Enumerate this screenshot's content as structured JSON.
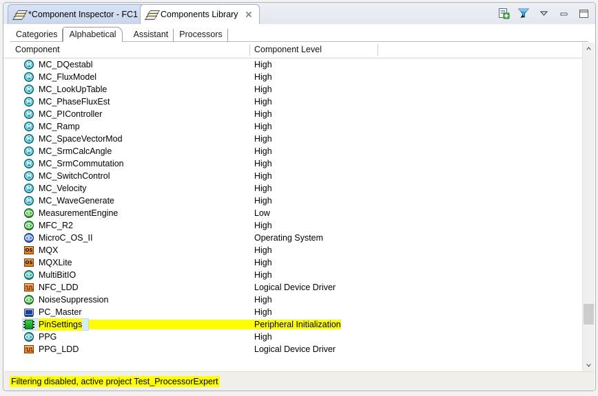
{
  "window": {
    "editor_tabs": [
      {
        "label": "*Component Inspector - FC1",
        "icon": "stacked-sheets-icon",
        "active": false,
        "closable": false
      },
      {
        "label": "Components Library",
        "icon": "stacked-sheets-icon",
        "active": true,
        "closable": true
      }
    ],
    "toolbar_icons": [
      {
        "name": "new-component-icon",
        "title": "New"
      },
      {
        "name": "filter-icon",
        "title": "Filter"
      },
      {
        "name": "view-menu-icon",
        "title": "View Menu"
      },
      {
        "name": "minimize-icon",
        "title": "Minimize"
      },
      {
        "name": "maximize-icon",
        "title": "Maximize"
      }
    ]
  },
  "subtabs": [
    {
      "label": "Categories",
      "selected": false
    },
    {
      "label": "Alphabetical",
      "selected": true
    },
    {
      "label": "Assistant",
      "selected": false
    },
    {
      "label": "Processors",
      "selected": false
    }
  ],
  "table": {
    "columns": [
      {
        "label": "Component"
      },
      {
        "label": "Component Level"
      }
    ],
    "rows": [
      {
        "name": "MC_DQestabl",
        "level": "High",
        "icon": "mc-component-icon",
        "icon_kind": "mc",
        "selected": false,
        "highlight_name": false,
        "highlight_level": false
      },
      {
        "name": "MC_FluxModel",
        "level": "High",
        "icon": "mc-component-icon",
        "icon_kind": "mc",
        "selected": false,
        "highlight_name": false,
        "highlight_level": false
      },
      {
        "name": "MC_LookUpTable",
        "level": "High",
        "icon": "mc-component-icon",
        "icon_kind": "mc",
        "selected": false,
        "highlight_name": false,
        "highlight_level": false
      },
      {
        "name": "MC_PhaseFluxEst",
        "level": "High",
        "icon": "mc-component-icon",
        "icon_kind": "mc",
        "selected": false,
        "highlight_name": false,
        "highlight_level": false
      },
      {
        "name": "MC_PIController",
        "level": "High",
        "icon": "mc-component-icon",
        "icon_kind": "mc",
        "selected": false,
        "highlight_name": false,
        "highlight_level": false
      },
      {
        "name": "MC_Ramp",
        "level": "High",
        "icon": "mc-component-icon",
        "icon_kind": "mc",
        "selected": false,
        "highlight_name": false,
        "highlight_level": false
      },
      {
        "name": "MC_SpaceVectorMod",
        "level": "High",
        "icon": "mc-component-icon",
        "icon_kind": "mc",
        "selected": false,
        "highlight_name": false,
        "highlight_level": false
      },
      {
        "name": "MC_SrmCalcAngle",
        "level": "High",
        "icon": "mc-component-icon",
        "icon_kind": "mc",
        "selected": false,
        "highlight_name": false,
        "highlight_level": false
      },
      {
        "name": "MC_SrmCommutation",
        "level": "High",
        "icon": "mc-component-icon",
        "icon_kind": "mc",
        "selected": false,
        "highlight_name": false,
        "highlight_level": false
      },
      {
        "name": "MC_SwitchControl",
        "level": "High",
        "icon": "mc-component-icon",
        "icon_kind": "mc",
        "selected": false,
        "highlight_name": false,
        "highlight_level": false
      },
      {
        "name": "MC_Velocity",
        "level": "High",
        "icon": "mc-component-icon",
        "icon_kind": "mc",
        "selected": false,
        "highlight_name": false,
        "highlight_level": false
      },
      {
        "name": "MC_WaveGenerate",
        "level": "High",
        "icon": "mc-component-icon",
        "icon_kind": "mc",
        "selected": false,
        "highlight_name": false,
        "highlight_level": false
      },
      {
        "name": "MeasurementEngine",
        "level": "Low",
        "icon": "measurement-engine-icon",
        "icon_kind": "green",
        "selected": false,
        "highlight_name": false,
        "highlight_level": false
      },
      {
        "name": "MFC_R2",
        "level": "High",
        "icon": "mfc-icon",
        "icon_kind": "green",
        "selected": false,
        "highlight_name": false,
        "highlight_level": false
      },
      {
        "name": "MicroC_OS_II",
        "level": "Operating System",
        "icon": "microc-os-icon",
        "icon_kind": "blue",
        "selected": false,
        "highlight_name": false,
        "highlight_level": false
      },
      {
        "name": "MQX",
        "level": "High",
        "icon": "os-icon",
        "icon_kind": "os",
        "selected": false,
        "highlight_name": false,
        "highlight_level": false
      },
      {
        "name": "MQXLite",
        "level": "High",
        "icon": "os-icon",
        "icon_kind": "os",
        "selected": false,
        "highlight_name": false,
        "highlight_level": false
      },
      {
        "name": "MultiBitIO",
        "level": "High",
        "icon": "multibit-io-icon",
        "icon_kind": "teal",
        "selected": false,
        "highlight_name": false,
        "highlight_level": false
      },
      {
        "name": "NFC_LDD",
        "level": "Logical Device Driver",
        "icon": "ldd-icon",
        "icon_kind": "ldd",
        "selected": false,
        "highlight_name": false,
        "highlight_level": false
      },
      {
        "name": "NoiseSuppression",
        "level": "High",
        "icon": "noise-suppression-icon",
        "icon_kind": "green",
        "selected": false,
        "highlight_name": false,
        "highlight_level": false
      },
      {
        "name": "PC_Master",
        "level": "High",
        "icon": "pc-master-icon",
        "icon_kind": "pcm",
        "selected": false,
        "highlight_name": false,
        "highlight_level": false
      },
      {
        "name": "PinSettings",
        "level": "Peripheral Initialization",
        "icon": "pin-settings-icon",
        "icon_kind": "pin",
        "selected": true,
        "highlight_name": true,
        "highlight_level": true
      },
      {
        "name": "PPG",
        "level": "High",
        "icon": "ppg-icon",
        "icon_kind": "greenblue",
        "selected": false,
        "highlight_name": false,
        "highlight_level": false
      },
      {
        "name": "PPG_LDD",
        "level": "Logical Device Driver",
        "icon": "ldd-icon",
        "icon_kind": "ldd",
        "selected": false,
        "highlight_name": false,
        "highlight_level": false
      }
    ]
  },
  "scrollbar": {
    "up_arrow": "▲",
    "down_arrow": "▼"
  },
  "status": {
    "message": "Filtering disabled, active project Test_ProcessorExpert"
  },
  "colors": {
    "highlight_yellow": "#ffff00",
    "selection_blue": "#d6ecf7",
    "tab_inactive": "#cbd9ee",
    "frame_border": "#a7b4cc"
  }
}
